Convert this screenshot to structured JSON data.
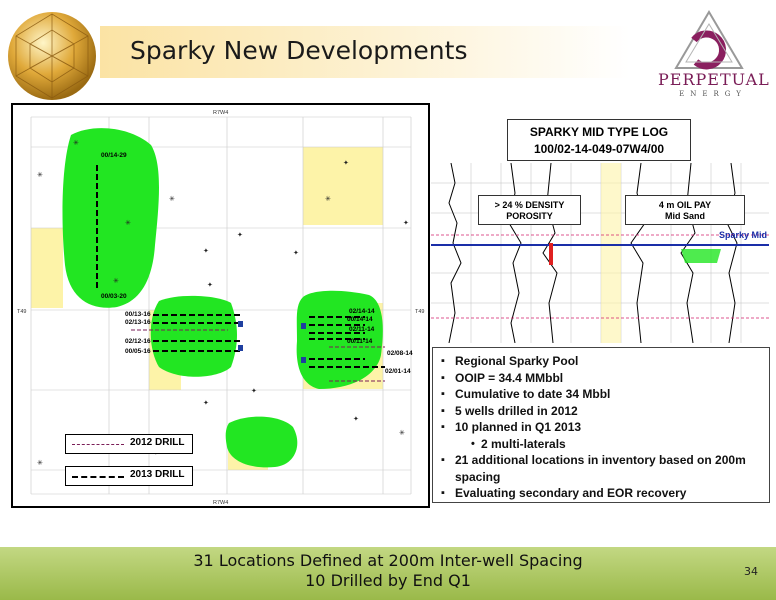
{
  "header": {
    "title": "Sparky New Developments",
    "company_name": "PERPETUAL",
    "company_sub": "ENERGY"
  },
  "map": {
    "range_label_top": "R7W4",
    "range_label_bottom": "R7W4",
    "township_left": "T49",
    "township_right": "T49",
    "well_labels": {
      "w1": "00/14-29",
      "w2": "00/03-20",
      "w3": "00/13-16",
      "w4": "02/13-16",
      "w5": "02/12-16",
      "w6": "00/05-16",
      "w7": "02/14-14",
      "w8": "00/14-14",
      "w9": "02/11-14",
      "w10": "00/11-14",
      "w11": "02/08-14",
      "w12": "02/01-14"
    },
    "legend": {
      "drill_2012": "2012 DRILL",
      "drill_2013": "2013 DRILL"
    }
  },
  "type_log": {
    "title_line1": "SPARKY MID TYPE LOG",
    "title_line2": "100/02-14-049-07W4/00",
    "density_line1": "> 24 % DENSITY",
    "density_line2": "POROSITY",
    "pay_line1": "4 m  OIL PAY",
    "pay_line2": "Mid Sand",
    "zone_label": "Sparky Mid"
  },
  "bullets": {
    "b1": "Regional Sparky Pool",
    "b2": "OOIP = 34.4 MMbbl",
    "b3": "Cumulative to date 34 Mbbl",
    "b4": "5 wells drilled in 2012",
    "b5": "10 planned in Q1 2013",
    "b6": "2 multi-laterals",
    "b7": "21 additional locations in inventory based on 200m spacing",
    "b8": "Evaluating secondary and EOR recovery"
  },
  "footer": {
    "line1": "31 Locations Defined at 200m Inter-well Spacing",
    "line2": "10 Drilled by End Q1",
    "page_number": "34"
  },
  "colors": {
    "accent_magenta": "#7a1d57",
    "pool_green": "#22e622",
    "lease_yellow": "#fdf3a8",
    "footer_green": "#a6c25a"
  }
}
